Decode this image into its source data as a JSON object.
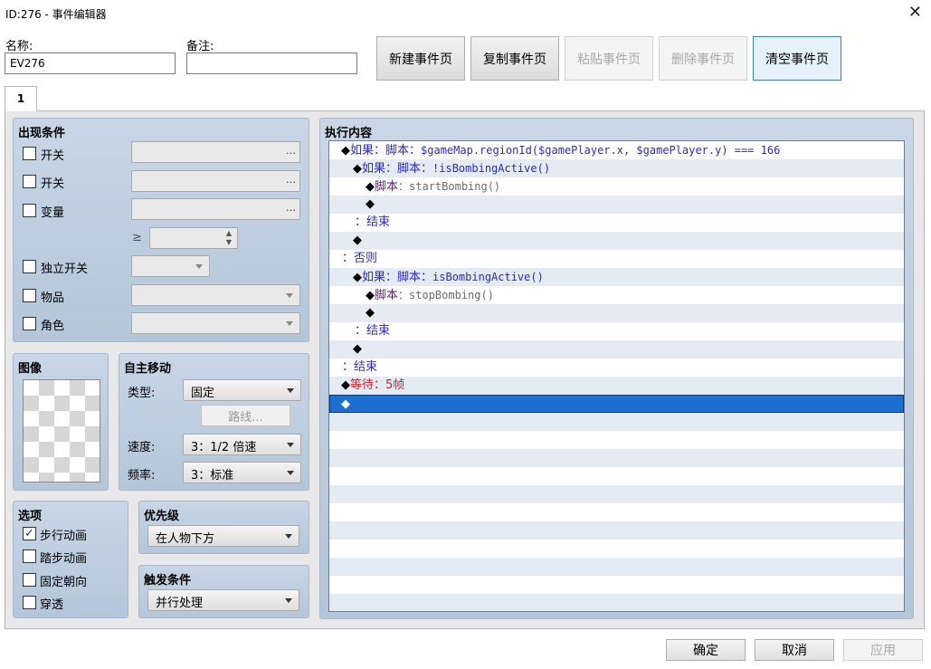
{
  "window": {
    "title": "ID:276 - 事件编辑器",
    "close_glyph": "✕"
  },
  "fields": {
    "name_label": "名称:",
    "name_value": "EV276",
    "note_label": "备注:",
    "note_value": ""
  },
  "toolbar": {
    "new_page": "新建事件页",
    "copy_page": "复制事件页",
    "paste_page": "粘贴事件页",
    "delete_page": "删除事件页",
    "clear_page": "清空事件页"
  },
  "tabs": [
    {
      "label": "1"
    }
  ],
  "conditions": {
    "title": "出现条件",
    "switch1": "开关",
    "switch2": "开关",
    "variable": "变量",
    "gte": "≥",
    "self_switch": "独立开关",
    "item": "物品",
    "actor": "角色",
    "ellipsis": "…"
  },
  "image": {
    "title": "图像"
  },
  "movement": {
    "title": "自主移动",
    "type_label": "类型:",
    "type_value": "固定",
    "route_button": "路线...",
    "speed_label": "速度:",
    "speed_value": "3：1/2 倍速",
    "freq_label": "频率:",
    "freq_value": "3：标准"
  },
  "options": {
    "title": "选项",
    "walking": "步行动画",
    "walking_checked": "✓",
    "stepping": "踏步动画",
    "direction_fix": "固定朝向",
    "through": "穿透"
  },
  "priority": {
    "title": "优先级",
    "value": "在人物下方"
  },
  "trigger": {
    "title": "触发条件",
    "value": "并行处理"
  },
  "contents": {
    "title": "执行内容",
    "lines": [
      {
        "mark": "◆",
        "a": "如果：脚本：",
        "b": "$gameMap.regionId($gamePlayer.x, $gamePlayer.y) === 166"
      },
      {
        "mark": "◆",
        "a": "如果：脚本：",
        "b": "!isBombingActive()"
      },
      {
        "mark": "◆",
        "a": "脚本",
        "b": "：startBombing()"
      },
      {
        "mark": "◆"
      },
      {
        "a": "：结束"
      },
      {
        "mark": "◆"
      },
      {
        "a": "：否则"
      },
      {
        "mark": "◆",
        "a": "如果：脚本：",
        "b": "isBombingActive()"
      },
      {
        "mark": "◆",
        "a": "脚本",
        "b": "：stopBombing()"
      },
      {
        "mark": "◆"
      },
      {
        "a": "：结束"
      },
      {
        "mark": "◆"
      },
      {
        "a": "：结束"
      },
      {
        "mark": "◆",
        "a": "等待：5帧"
      },
      {
        "mark": "◆"
      }
    ]
  },
  "footer": {
    "ok": "确定",
    "cancel": "取消",
    "apply": "应用"
  }
}
